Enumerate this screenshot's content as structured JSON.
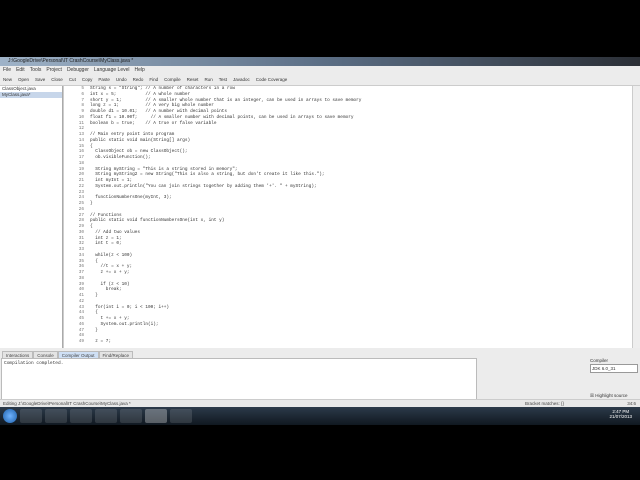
{
  "window": {
    "title": "J:\\GoogleDrive\\Personal\\IT CrashCourse\\MyClass.java *"
  },
  "menu": [
    "File",
    "Edit",
    "Tools",
    "Project",
    "Debugger",
    "Language Level",
    "Help"
  ],
  "toolbar": [
    "New",
    "Open",
    "Save",
    "Close",
    "Cut",
    "Copy",
    "Paste",
    "Undo",
    "Redo",
    "Find",
    "Compile",
    "Reset",
    "Run",
    "Test",
    "Javadoc",
    "Code Coverage"
  ],
  "files": [
    "ClassObject.java",
    "MyClass.java*"
  ],
  "code": {
    "start": 5,
    "lines": [
      "String s = \"String\"; // A number of characters in a row",
      "int x = 5;           // A whole number",
      "short y = 1;         // A smaller whole number that is an integer, can be used in arrays to save memory",
      "long z = 1;          // A very big whole number",
      "double d1 = 10.01;   // A number with decimal points",
      "float f1 = 10.00f;     // A smaller number with decimal points, can be used in arrays to save memory",
      "boolean b = true;    // A true or false variable",
      "",
      "// Main entry point into program",
      "public static void main(String[] args)",
      "{",
      "  ClassObject ob = new ClassObject();",
      "  ob.visibleFunction();",
      "",
      "  String myString = \"This is a string stored in memory\";",
      "  String myString2 = new String(\"This is also a string, but don't create it like this.\");",
      "  int myInt = 1;",
      "  System.out.println(\"You can join strings together by adding them '+'. \" + myString);",
      "",
      "  functionNumbersOne(myInt, 3);",
      "}",
      "",
      "// Functions",
      "public static void functionNumbersOne(int x, int y)",
      "{",
      "  // Add two values",
      "  int z = 1;",
      "  int t = 0;",
      "",
      "  while(z < 100)",
      "  {",
      "    //t = x + y;",
      "    z += x + y;",
      "",
      "    if (z < 10)",
      "      break;",
      "  }",
      "",
      "  for(int i = 0; i < 100; i++)",
      "  {",
      "    t += x + y;",
      "    System.out.println(i);",
      "  }",
      "",
      "  z = 7;"
    ]
  },
  "bottom_tabs": [
    "Interactions",
    "Console",
    "Compiler Output",
    "Find/Replace"
  ],
  "output": "Compilation completed.",
  "compiler": {
    "label": "Compiler",
    "value": "JDK 6.0_31",
    "highlight": "Highlight source"
  },
  "status": {
    "path": "Editing J:\\GoogleDrive\\Personal\\IT CrashCourse\\MyClass.java *",
    "bracket": "Bracket matches:  {}",
    "pos": "34:6"
  },
  "clock": {
    "time": "2:47 PM",
    "date": "21/07/2013"
  }
}
